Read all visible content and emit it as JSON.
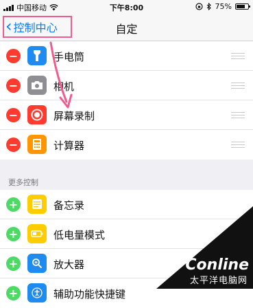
{
  "status": {
    "carrier": "中国移动",
    "time": "下午8:00",
    "battery": "75%",
    "battery_level": 0.75
  },
  "nav": {
    "back_label": "控制中心",
    "title": "自定"
  },
  "included": [
    {
      "label": "手电筒",
      "icon": "flashlight-icon",
      "color": "#1e8bf0"
    },
    {
      "label": "相机",
      "icon": "camera-icon",
      "color": "#8e8e93"
    },
    {
      "label": "屏幕录制",
      "icon": "screen-record-icon",
      "color": "#ff3b30"
    },
    {
      "label": "计算器",
      "icon": "calculator-icon",
      "color": "#ff9500"
    }
  ],
  "more_controls": {
    "header": "更多控制",
    "items": [
      {
        "label": "备忘录",
        "icon": "notes-icon",
        "color": "#ffcc00"
      },
      {
        "label": "低电量模式",
        "icon": "battery-icon",
        "color": "#ffcc00"
      },
      {
        "label": "放大器",
        "icon": "magnifier-icon",
        "color": "#1e8bf0"
      },
      {
        "label": "辅助功能快捷键",
        "icon": "accessibility-icon",
        "color": "#1e8bf0"
      }
    ]
  },
  "watermark": {
    "brand": "PConline",
    "sub": "太平洋电脑网"
  },
  "colors": {
    "accent": "#007aff",
    "highlight": "#f25b8f",
    "remove": "#ff3b30",
    "add": "#4cd964"
  }
}
